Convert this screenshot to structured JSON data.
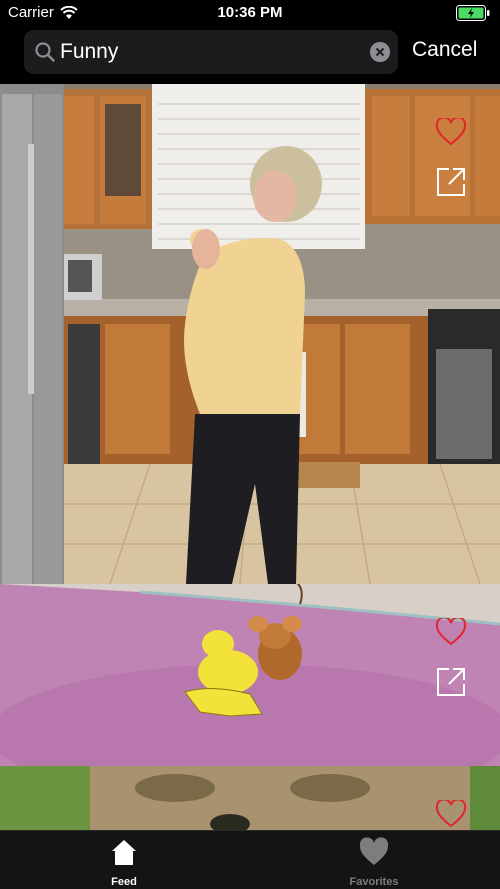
{
  "status_bar": {
    "carrier": "Carrier",
    "time": "10:36 PM",
    "battery_color": "#4cd964"
  },
  "search": {
    "value": "Funny",
    "cancel_label": "Cancel"
  },
  "feed": {
    "items": [
      {
        "scene": "woman dancing in kitchen",
        "liked": false
      },
      {
        "scene": "cartoon bird and mouse",
        "liked": false
      },
      {
        "scene": "close-up face",
        "liked": false
      }
    ],
    "like_color": "#e0262c"
  },
  "tab_bar": {
    "tabs": [
      {
        "label": "Feed",
        "icon": "home-icon",
        "selected": true
      },
      {
        "label": "Favorites",
        "icon": "heart-icon",
        "selected": false
      }
    ],
    "selected_color": "#ffffff",
    "unselected_color": "#7d7d7d"
  }
}
